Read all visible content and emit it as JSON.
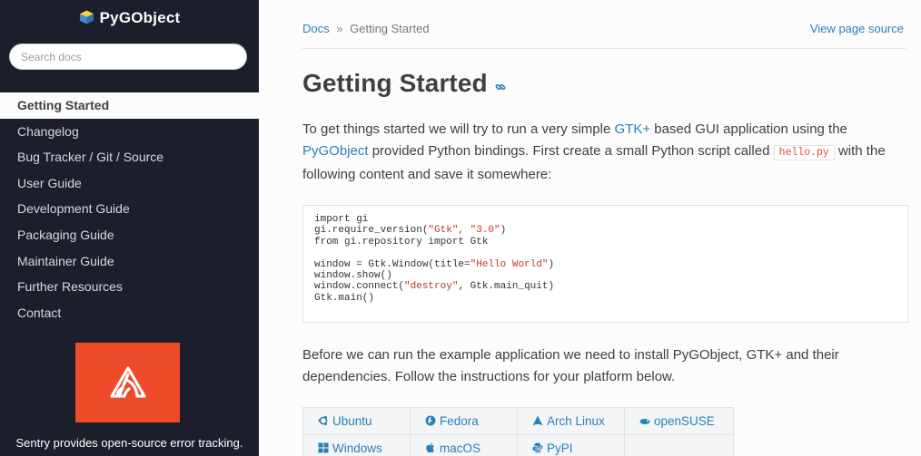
{
  "sidebar": {
    "brand": "PyGObject",
    "search_placeholder": "Search docs",
    "nav": [
      {
        "label": "Getting Started",
        "active": true
      },
      {
        "label": "Changelog"
      },
      {
        "label": "Bug Tracker / Git / Source"
      },
      {
        "label": "User Guide"
      },
      {
        "label": "Development Guide"
      },
      {
        "label": "Packaging Guide"
      },
      {
        "label": "Maintainer Guide"
      },
      {
        "label": "Further Resources"
      },
      {
        "label": "Contact"
      }
    ],
    "sentry_text": "Sentry provides open-source error tracking."
  },
  "breadcrumb": {
    "docs": "Docs",
    "separator": "»",
    "current": "Getting Started",
    "view_source": "View page source"
  },
  "page": {
    "title": "Getting Started",
    "intro": {
      "part1": "To get things started we will try to run a very simple ",
      "link_gtk": "GTK+",
      "part2": " based GUI application using the ",
      "link_pygobject": "PyGObject",
      "part3": " provided Python bindings. First create a small Python script called ",
      "code": "hello.py",
      "part4": " with the following content and save it somewhere:"
    },
    "code_lines": [
      {
        "pre": "import gi"
      },
      {
        "pre": "gi.require_version(",
        "str": "\"Gtk\", \"3.0\"",
        "post": ")"
      },
      {
        "pre": "from gi.repository import Gtk"
      },
      {
        "pre": ""
      },
      {
        "pre": "window = Gtk.Window(title=",
        "str": "\"Hello World\"",
        "post": ")"
      },
      {
        "pre": "window.show()"
      },
      {
        "pre": "window.connect(",
        "str": "\"destroy\"",
        "post": ", Gtk.main_quit)"
      },
      {
        "pre": "Gtk.main()"
      }
    ],
    "install_text": "Before we can run the example application we need to install PyGObject, GTK+ and their dependencies. Follow the instructions for your platform below."
  },
  "platforms": [
    {
      "label": "Ubuntu",
      "icon": "ubuntu-icon"
    },
    {
      "label": "Fedora",
      "icon": "fedora-icon"
    },
    {
      "label": "Arch Linux",
      "icon": "arch-icon"
    },
    {
      "label": "openSUSE",
      "icon": "opensuse-icon"
    },
    {
      "label": "Windows",
      "icon": "windows-icon"
    },
    {
      "label": "macOS",
      "icon": "apple-icon"
    },
    {
      "label": "PyPI",
      "icon": "python-icon"
    }
  ],
  "colors": {
    "sidebar_bg": "#1c1e2c",
    "link": "#2980b9",
    "sentry": "#ee4b2b",
    "code_inline": "#e74c3c"
  }
}
